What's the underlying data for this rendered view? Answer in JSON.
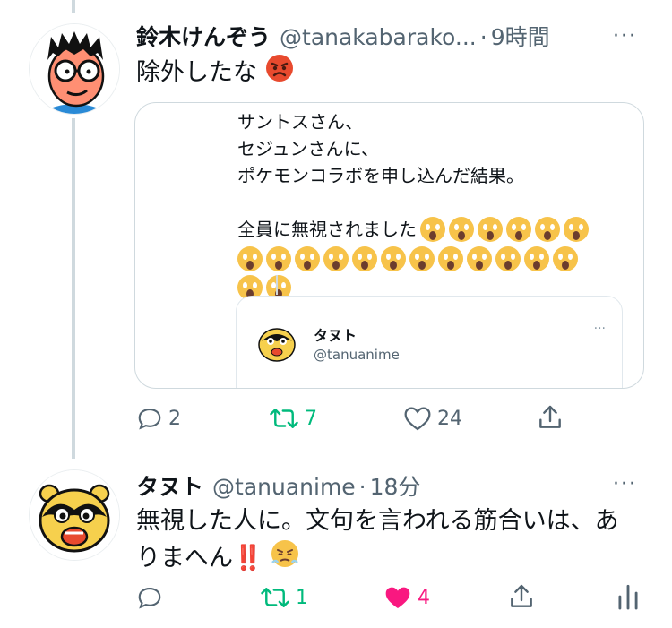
{
  "tweets": [
    {
      "name": "鈴木けんぞう",
      "handle": "@tanakabarako...",
      "time": "9時間",
      "text": "除外したな",
      "reply_count": "2",
      "retweet_count": "7",
      "like_count": "24",
      "quote": {
        "line1": "サントスさん、",
        "line2": "セジュンさんに、",
        "line3": "ポケモンコラボを申し込んだ結果。",
        "line4": "全員に無視されました",
        "inner_name": "タヌト",
        "inner_handle": "@tanuanime"
      }
    },
    {
      "name": "タヌト",
      "handle": "@tanuanime",
      "time": "18分",
      "text_line1": "無視した人に。文句を言われる筋合いは、あ",
      "text_line2": "りまへん",
      "reply_count": "",
      "retweet_count": "1",
      "like_count": "4"
    }
  ],
  "ui": {
    "dot": "·",
    "more": "···",
    "bang": "‼️"
  },
  "colors": {
    "accent_green": "#00ba7c",
    "like_pink": "#f91880",
    "muted": "#536471"
  }
}
